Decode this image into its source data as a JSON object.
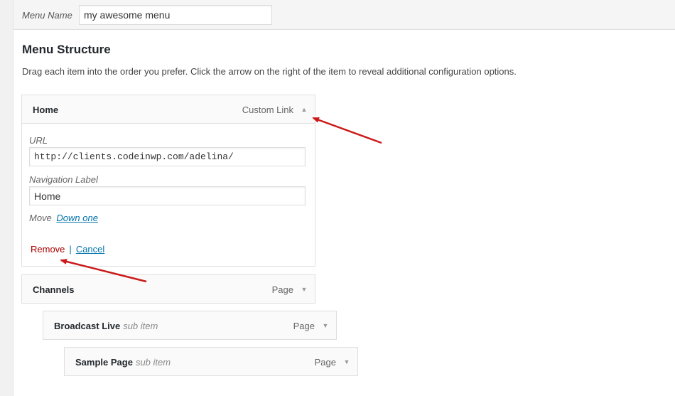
{
  "menu_name": {
    "label": "Menu Name",
    "value": "my awesome menu"
  },
  "structure": {
    "title": "Menu Structure",
    "description": "Drag each item into the order you prefer. Click the arrow on the right of the item to reveal additional configuration options."
  },
  "items": [
    {
      "title": "Home",
      "sub": "",
      "type": "Custom Link",
      "toggle": "up-arrow-icon",
      "expanded": true
    },
    {
      "title": "Channels",
      "sub": "",
      "type": "Page",
      "toggle": "down-arrow-icon"
    },
    {
      "title": "Broadcast Live",
      "sub": "sub item",
      "type": "Page",
      "toggle": "down-arrow-icon"
    },
    {
      "title": "Sample Page",
      "sub": "sub item",
      "type": "Page",
      "toggle": "down-arrow-icon"
    }
  ],
  "settings": {
    "url_label": "URL",
    "url_value": "http://clients.codeinwp.com/adelina/",
    "nav_label": "Navigation Label",
    "nav_value": "Home",
    "move_label": "Move",
    "move_link": "Down one",
    "remove": "Remove",
    "separator": "|",
    "cancel": "Cancel"
  },
  "colors": {
    "annotation_arrow": "#cc1a1a",
    "link": "#0073aa",
    "remove": "#aa0000"
  }
}
